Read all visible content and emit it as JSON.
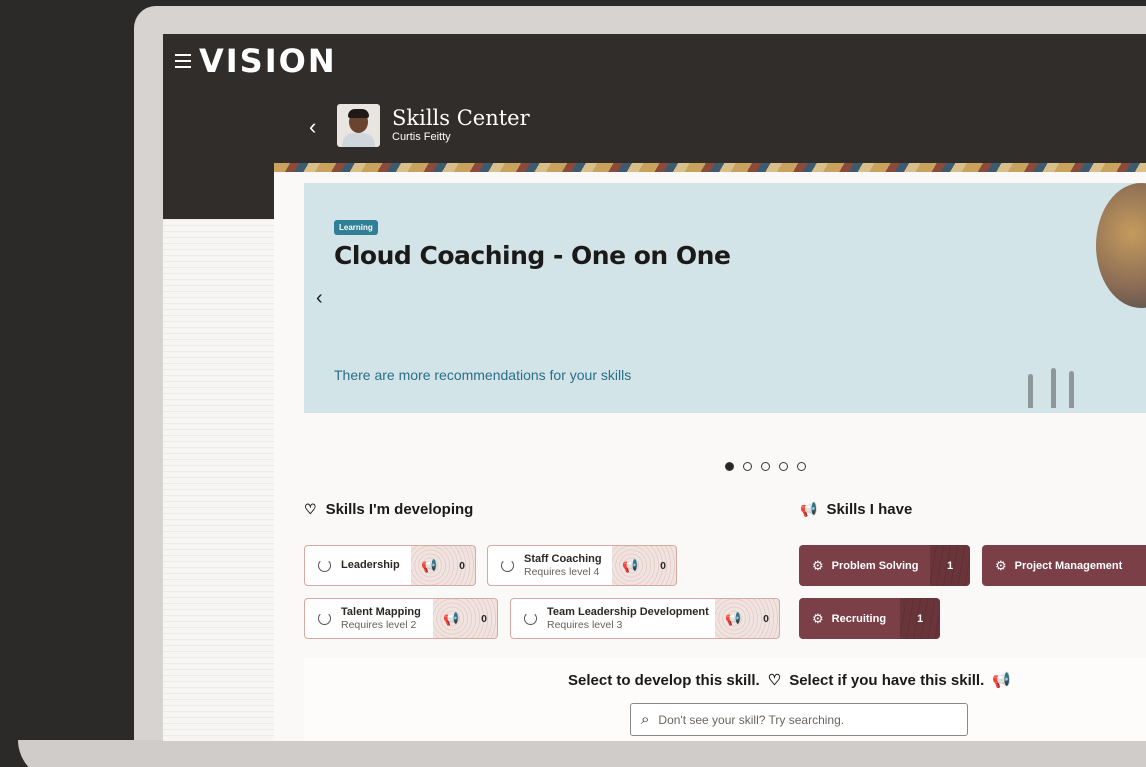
{
  "app": {
    "logo": "VISION",
    "menu_icon": "hamburger-icon"
  },
  "header": {
    "title": "Skills Center",
    "subtitle": "Curtis Feitty",
    "back_icon": "chevron-left-icon"
  },
  "hero": {
    "badge": "Learning",
    "title": "Cloud Coaching - One on One",
    "link": "There are more recommendations for your skills",
    "prev_icon": "chevron-left-icon",
    "slide_count": 5,
    "active_slide": 1
  },
  "developing": {
    "heading": "Skills I'm developing",
    "icon": "heart-icon",
    "skills": [
      {
        "name": "Leadership",
        "requirement": "",
        "count": "0"
      },
      {
        "name": "Staff Coaching",
        "requirement": "Requires level 4",
        "count": "0"
      },
      {
        "name": "Talent Mapping",
        "requirement": "Requires level 2",
        "count": "0"
      },
      {
        "name": "Team Leadership Development",
        "requirement": "Requires level 3",
        "count": "0"
      }
    ]
  },
  "have": {
    "heading": "Skills I have",
    "icon": "megaphone-icon",
    "skills": [
      {
        "name": "Problem Solving",
        "count": "1"
      },
      {
        "name": "Project Management",
        "count": ""
      },
      {
        "name": "Recruiting",
        "count": "1"
      }
    ]
  },
  "select": {
    "develop_text": "Select to develop this skill.",
    "have_text": "Select if you have this skill.",
    "search_placeholder": "Don't see your skill? Try searching."
  },
  "colors": {
    "header_bg": "#312d2a",
    "hero_bg": "#d3e4e8",
    "badge": "#2f7f96",
    "have_chip": "#7b3f47",
    "link": "#2a6f86"
  }
}
